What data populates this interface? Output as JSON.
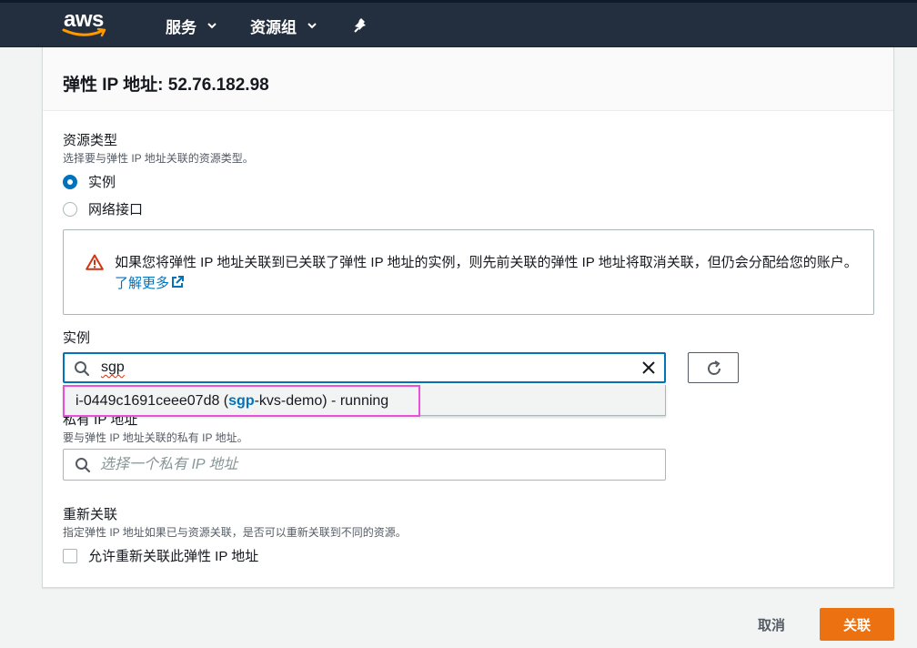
{
  "topnav": {
    "logo_text": "aws",
    "services_label": "服务",
    "resource_groups_label": "资源组"
  },
  "page": {
    "title": "弹性 IP 地址: 52.76.182.98"
  },
  "resource_type": {
    "label": "资源类型",
    "description": "选择要与弹性 IP 地址关联的资源类型。",
    "options": [
      {
        "label": "实例",
        "checked": true
      },
      {
        "label": "网络接口",
        "checked": false
      }
    ]
  },
  "alert": {
    "text": "如果您将弹性 IP 地址关联到已关联了弹性 IP 地址的实例，则先前关联的弹性 IP 地址将取消关联，但仍会分配给您的账户。",
    "link": "了解更多"
  },
  "instance": {
    "label": "实例",
    "search_value": "sgp",
    "suggestion": {
      "prefix": "i-0449c1691ceee07d8 (",
      "highlight": "sgp",
      "suffix": "-kvs-demo) - running"
    }
  },
  "private_ip": {
    "label": "私有 IP 地址",
    "description": "要与弹性 IP 地址关联的私有 IP 地址。",
    "placeholder": "选择一个私有 IP 地址"
  },
  "reassociation": {
    "label": "重新关联",
    "description": "指定弹性 IP 地址如果已与资源关联，是否可以重新关联到不同的资源。",
    "checkbox_label": "允许重新关联此弹性 IP 地址",
    "checked": false
  },
  "actions": {
    "cancel": "取消",
    "associate": "关联"
  },
  "colors": {
    "nav_bg": "#232f3e",
    "primary": "#ec7211",
    "link": "#0073bb",
    "highlight_border": "#e94fd8",
    "warning": "#d13212"
  }
}
